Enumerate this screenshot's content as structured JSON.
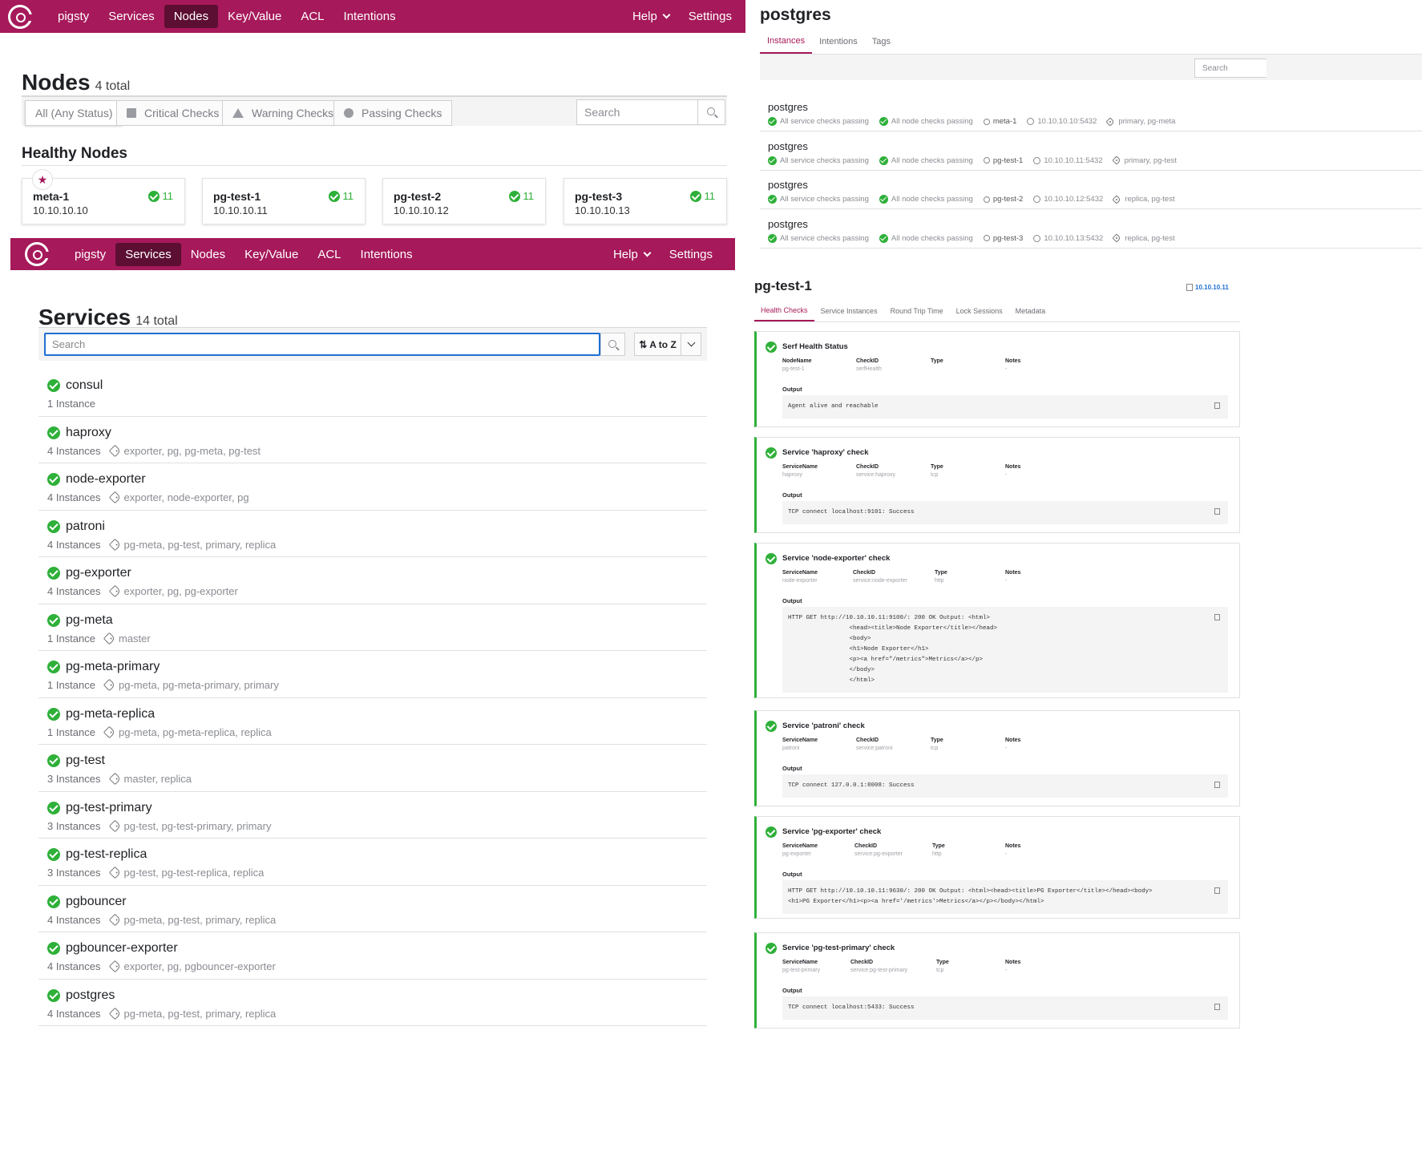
{
  "colors": {
    "brand": "#a6195a",
    "passing": "#2eb039",
    "link": "#1f6fd1"
  },
  "nav": {
    "brand": "pigsty",
    "items": [
      "Services",
      "Nodes",
      "Key/Value",
      "ACL",
      "Intentions"
    ],
    "help": "Help",
    "settings": "Settings"
  },
  "nodes_page": {
    "title": "Nodes",
    "total": "4 total",
    "filters": [
      "All (Any Status)",
      "Critical Checks",
      "Warning Checks",
      "Passing Checks"
    ],
    "search_placeholder": "Search",
    "healthy_title": "Healthy Nodes",
    "leader_icon": "star-icon",
    "nodes": [
      {
        "name": "meta-1",
        "ip": "10.10.10.10",
        "checks": "11"
      },
      {
        "name": "pg-test-1",
        "ip": "10.10.10.11",
        "checks": "11"
      },
      {
        "name": "pg-test-2",
        "ip": "10.10.10.12",
        "checks": "11"
      },
      {
        "name": "pg-test-3",
        "ip": "10.10.10.13",
        "checks": "11"
      }
    ]
  },
  "services_page": {
    "title": "Services",
    "total": "14 total",
    "search_placeholder": "Search",
    "sort_label": "A to Z",
    "services": [
      {
        "name": "consul",
        "instances": "1 Instance",
        "tags": ""
      },
      {
        "name": "haproxy",
        "instances": "4 Instances",
        "tags": "exporter, pg, pg-meta, pg-test"
      },
      {
        "name": "node-exporter",
        "instances": "4 Instances",
        "tags": "exporter, node-exporter, pg"
      },
      {
        "name": "patroni",
        "instances": "4 Instances",
        "tags": "pg-meta, pg-test, primary, replica"
      },
      {
        "name": "pg-exporter",
        "instances": "4 Instances",
        "tags": "exporter, pg, pg-exporter"
      },
      {
        "name": "pg-meta",
        "instances": "1 Instance",
        "tags": "master"
      },
      {
        "name": "pg-meta-primary",
        "instances": "1 Instance",
        "tags": "pg-meta, pg-meta-primary, primary"
      },
      {
        "name": "pg-meta-replica",
        "instances": "1 Instance",
        "tags": "pg-meta, pg-meta-replica, replica"
      },
      {
        "name": "pg-test",
        "instances": "3 Instances",
        "tags": "master, replica"
      },
      {
        "name": "pg-test-primary",
        "instances": "3 Instances",
        "tags": "pg-test, pg-test-primary, primary"
      },
      {
        "name": "pg-test-replica",
        "instances": "3 Instances",
        "tags": "pg-test, pg-test-replica, replica"
      },
      {
        "name": "pgbouncer",
        "instances": "4 Instances",
        "tags": "pg-meta, pg-test, primary, replica"
      },
      {
        "name": "pgbouncer-exporter",
        "instances": "4 Instances",
        "tags": "exporter, pg, pgbouncer-exporter"
      },
      {
        "name": "postgres",
        "instances": "4 Instances",
        "tags": "pg-meta, pg-test, primary, replica"
      }
    ]
  },
  "postgres_page": {
    "title": "postgres",
    "tabs": [
      "Instances",
      "Intentions",
      "Tags"
    ],
    "search_placeholder": "Search",
    "instances": [
      {
        "name": "postgres",
        "svc": "All service checks passing",
        "node_checks": "All node checks passing",
        "node": "meta-1",
        "addr": "10.10.10.10:5432",
        "tags": "primary, pg-meta"
      },
      {
        "name": "postgres",
        "svc": "All service checks passing",
        "node_checks": "All node checks passing",
        "node": "pg-test-1",
        "addr": "10.10.10.11:5432",
        "tags": "primary, pg-test"
      },
      {
        "name": "postgres",
        "svc": "All service checks passing",
        "node_checks": "All node checks passing",
        "node": "pg-test-2",
        "addr": "10.10.10.12:5432",
        "tags": "replica, pg-test"
      },
      {
        "name": "postgres",
        "svc": "All service checks passing",
        "node_checks": "All node checks passing",
        "node": "pg-test-3",
        "addr": "10.10.10.13:5432",
        "tags": "replica, pg-test"
      }
    ]
  },
  "node_detail": {
    "title": "pg-test-1",
    "address": "10.10.10.11",
    "tabs": [
      "Health Checks",
      "Service Instances",
      "Round Trip Time",
      "Lock Sessions",
      "Metadata"
    ],
    "output_label": "Output",
    "checks": [
      {
        "title": "Serf Health Status",
        "f1": "NodeName",
        "v1": "pg-test-1",
        "f2": "CheckID",
        "v2": "serfHealth",
        "f3": "Type",
        "v3": "",
        "f4": "Notes",
        "v4": "-",
        "output": "Agent alive and reachable"
      },
      {
        "title": "Service 'haproxy' check",
        "f1": "ServiceName",
        "v1": "haproxy",
        "f2": "CheckID",
        "v2": "service:haproxy",
        "f3": "Type",
        "v3": "tcp",
        "f4": "Notes",
        "v4": "-",
        "output": "TCP connect localhost:9101: Success"
      },
      {
        "title": "Service 'node-exporter' check",
        "f1": "ServiceName",
        "v1": "node-exporter",
        "f2": "CheckID",
        "v2": "service:node-exporter",
        "f3": "Type",
        "v3": "http",
        "f4": "Notes",
        "v4": "-",
        "output": "HTTP GET http://10.10.10.11:9100/: 200 OK Output: <html>\n                 <head><title>Node Exporter</title></head>\n                 <body>\n                 <h1>Node Exporter</h1>\n                 <p><a href=\"/metrics\">Metrics</a></p>\n                 </body>\n                 </html>"
      },
      {
        "title": "Service 'patroni' check",
        "f1": "ServiceName",
        "v1": "patroni",
        "f2": "CheckID",
        "v2": "service:patroni",
        "f3": "Type",
        "v3": "tcp",
        "f4": "Notes",
        "v4": "-",
        "output": "TCP connect 127.0.0.1:8008: Success"
      },
      {
        "title": "Service 'pg-exporter' check",
        "f1": "ServiceName",
        "v1": "pg-exporter",
        "f2": "CheckID",
        "v2": "service:pg-exporter",
        "f3": "Type",
        "v3": "http",
        "f4": "Notes",
        "v4": "-",
        "output": "HTTP GET http://10.10.10.11:9630/: 200 OK Output: <html><head><title>PG Exporter</title></head><body>\n<h1>PG Exporter</h1><p><a href='/metrics'>Metrics</a></p></body></html>"
      },
      {
        "title": "Service 'pg-test-primary' check",
        "f1": "ServiceName",
        "v1": "pg-test-primary",
        "f2": "CheckID",
        "v2": "service:pg-test-primary",
        "f3": "Type",
        "v3": "tcp",
        "f4": "Notes",
        "v4": "-",
        "output": "TCP connect localhost:5433: Success"
      }
    ]
  }
}
